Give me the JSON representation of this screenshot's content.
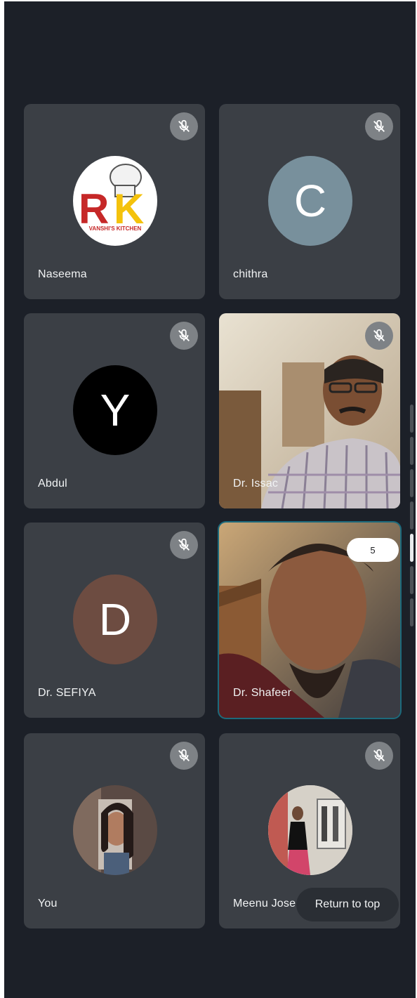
{
  "participants": [
    {
      "name": "Naseema",
      "muted": true,
      "avatar": "rk-kitchen-logo",
      "avatar_text": "RK",
      "logo_subtext": "VANSHI'S KITCHEN"
    },
    {
      "name": "chithra",
      "muted": true,
      "avatar_letter": "C",
      "avatar_color": "#78909c"
    },
    {
      "name": "Abdul",
      "muted": true,
      "avatar_letter": "Y",
      "avatar_color": "#000000"
    },
    {
      "name": "Dr. Issac",
      "muted": true,
      "video": "camera-feed-man-glasses"
    },
    {
      "name": "Dr. SEFIYA",
      "muted": true,
      "avatar_letter": "D",
      "avatar_color": "#6d4c41"
    },
    {
      "name": "Dr. Shafeer",
      "muted": false,
      "video": "camera-feed-young-man",
      "active_speaker": true,
      "badge": "5"
    },
    {
      "name": "You",
      "muted": true,
      "avatar": "profile-photo-woman"
    },
    {
      "name": "Meenu Jose",
      "muted": true,
      "avatar": "profile-photo-woman-corridor"
    }
  ],
  "return_to_top_label": "Return to top",
  "colors": {
    "background": "#1c2028",
    "tile": "#3b3f45",
    "active_border": "#1c6a7c"
  }
}
